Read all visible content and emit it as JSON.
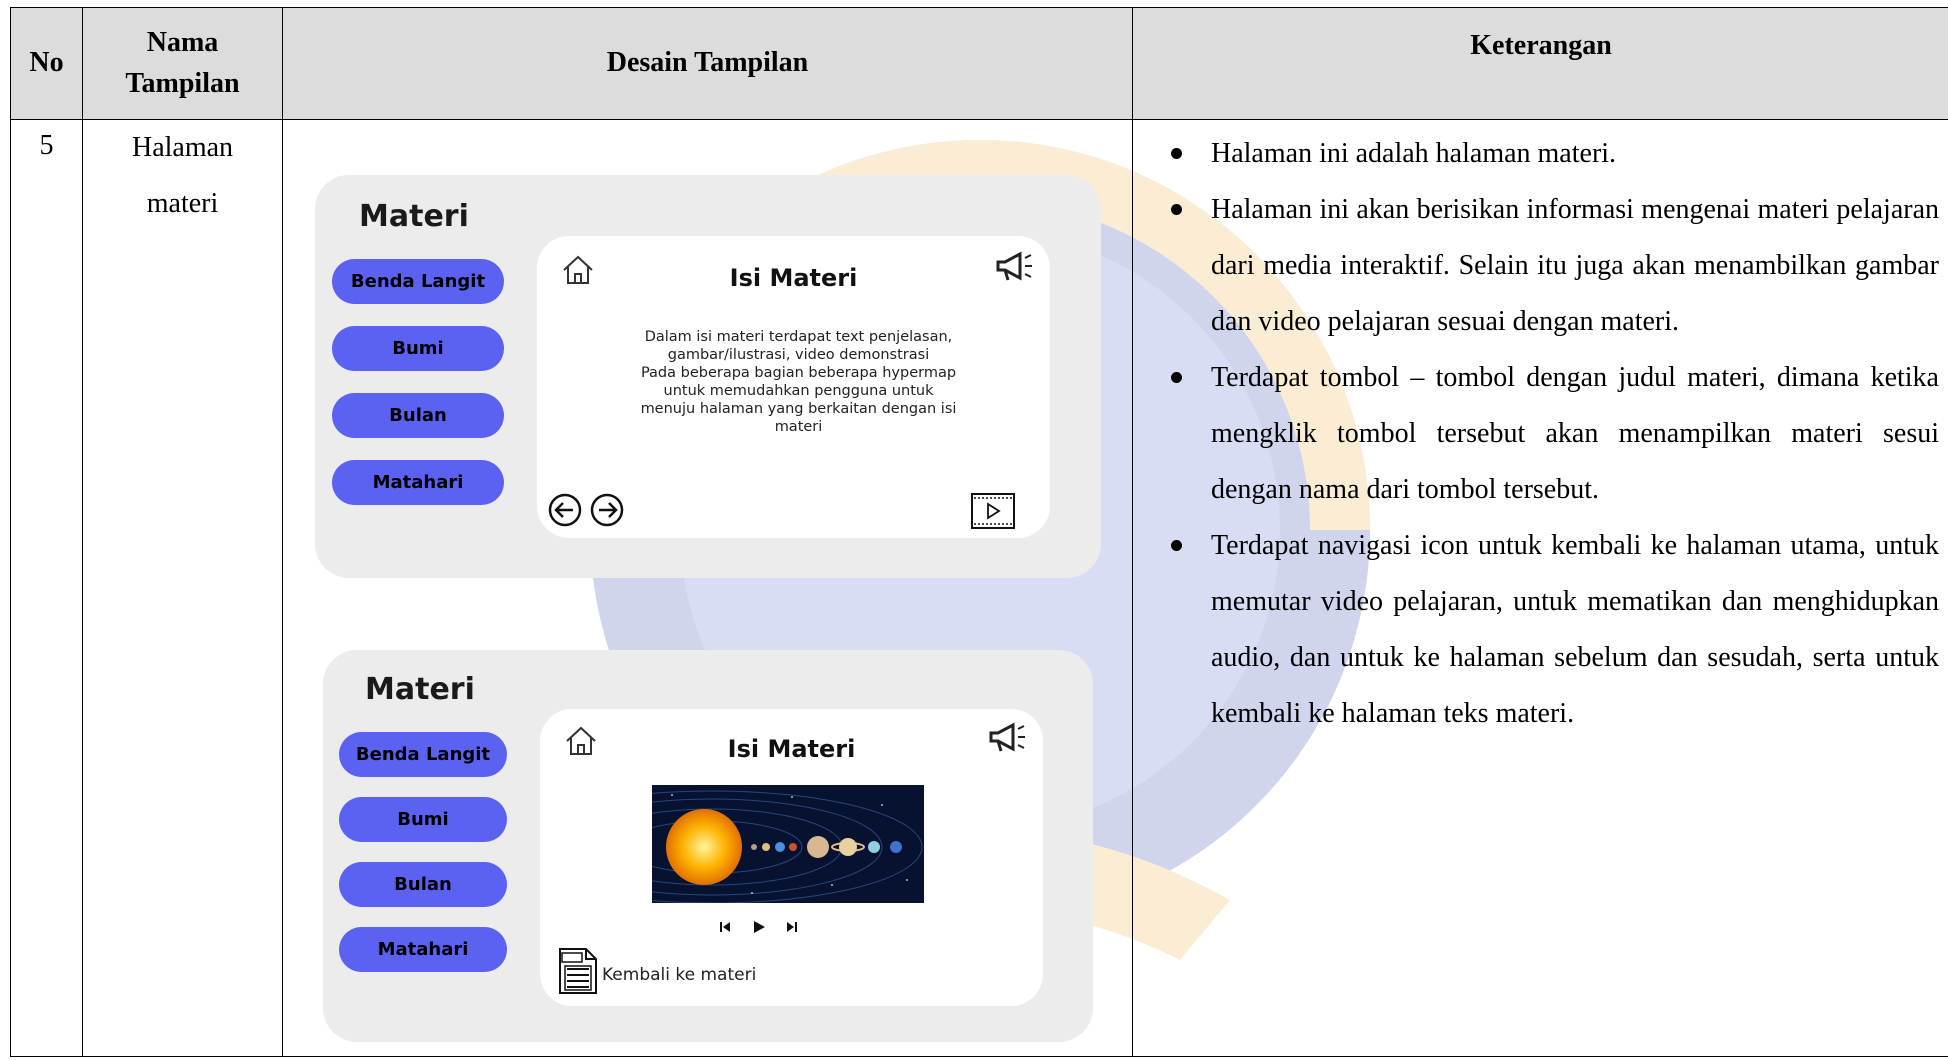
{
  "table": {
    "headers": {
      "no": "No",
      "nama": "Nama Tampilan",
      "nama_line1": "Nama",
      "nama_line2": "Tampilan",
      "desain": "Desain Tampilan",
      "keterangan": "Keterangan"
    },
    "row": {
      "no": "5",
      "nama_line1": "Halaman",
      "nama_line2": "materi",
      "keterangan": [
        "Halaman ini adalah halaman materi.",
        "Halaman ini akan berisikan informasi mengenai materi pelajaran dari media interaktif. Selain itu juga akan menambilkan gambar dan video pelajaran sesuai dengan materi.",
        "Terdapat tombol – tombol dengan judul materi, dimana ketika mengklik tombol tersebut akan menampilkan materi sesui dengan nama dari tombol tersebut.",
        "Terdapat navigasi icon untuk kembali ke halaman utama, untuk memutar video pelajaran, untuk mematikan dan menghidupkan audio, dan untuk ke halaman sebelum dan sesudah, serta untuk kembali ke halaman teks materi."
      ]
    }
  },
  "mockup1": {
    "title": "Materi",
    "buttons": [
      "Benda Langit",
      "Bumi",
      "Bulan",
      "Matahari"
    ],
    "panel_title": "Isi Materi",
    "panel_text_lines": [
      "Dalam isi materi terdapat text penjelasan,",
      "gambar/ilustrasi, video demonstrasi",
      "Pada beberapa bagian beberapa hypermap",
      "untuk memudahkan pengguna untuk",
      "menuju halaman yang berkaitan dengan isi",
      "materi"
    ],
    "icons": [
      "home-icon",
      "megaphone-icon",
      "arrow-left-circle-icon",
      "arrow-right-circle-icon",
      "video-play-icon"
    ]
  },
  "mockup2": {
    "title": "Materi",
    "buttons": [
      "Benda Langit",
      "Bumi",
      "Bulan",
      "Matahari"
    ],
    "panel_title": "Isi Materi",
    "image": "solar-system-image",
    "media_controls": [
      "skip-back-icon",
      "play-icon",
      "skip-forward-icon"
    ],
    "back_label": "Kembali ke materi",
    "icons": [
      "home-icon",
      "megaphone-icon",
      "text-document-icon"
    ]
  },
  "colors": {
    "button": "#5b62f2",
    "card_bg": "#ececec",
    "header_bg": "#d9d9d9",
    "watermark_blue": "#2f3fb0",
    "watermark_gold": "#f0b23a"
  }
}
